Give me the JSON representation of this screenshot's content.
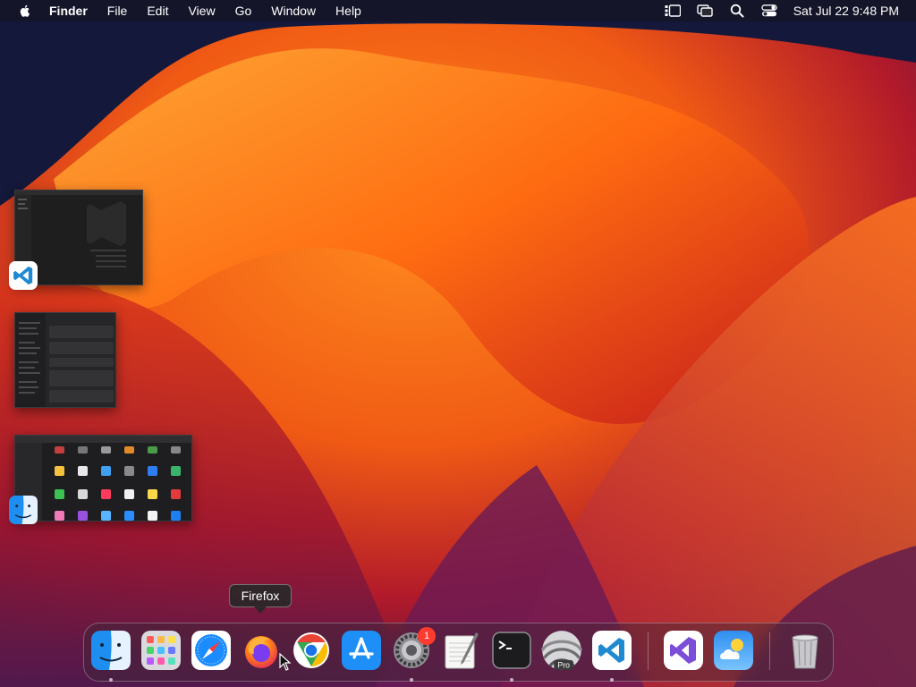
{
  "menubar": {
    "app_name": "Finder",
    "items": [
      "File",
      "Edit",
      "View",
      "Go",
      "Window",
      "Help"
    ],
    "status_icons": [
      "stage-manager-icon",
      "screen-mirroring-icon",
      "spotlight-search-icon",
      "control-center-icon"
    ],
    "clock": "Sat Jul 22  9:48 PM"
  },
  "stage_manager": [
    {
      "app": "Visual Studio Code",
      "icon": "vscode-icon"
    },
    {
      "app": "System Settings",
      "icon": "settings-window-thumbnail"
    },
    {
      "app": "Finder",
      "icon": "finder-icon"
    }
  ],
  "tooltip": {
    "label": "Firefox"
  },
  "dock": {
    "items": [
      {
        "name": "Finder",
        "icon": "finder-icon",
        "running": true
      },
      {
        "name": "Launchpad",
        "icon": "launchpad-icon",
        "running": false
      },
      {
        "name": "Safari",
        "icon": "safari-icon",
        "running": false
      },
      {
        "name": "Firefox",
        "icon": "firefox-icon",
        "running": false
      },
      {
        "name": "Google Chrome",
        "icon": "chrome-icon",
        "running": false
      },
      {
        "name": "App Store",
        "icon": "app-store-icon",
        "running": false
      },
      {
        "name": "System Settings",
        "icon": "settings-gear-icon",
        "running": true,
        "badge": "1"
      },
      {
        "name": "TextEdit",
        "icon": "textedit-icon",
        "running": false
      },
      {
        "name": "Terminal",
        "icon": "terminal-icon",
        "running": true
      },
      {
        "name": "Pro",
        "icon": "pro-app-icon",
        "running": false,
        "label": "Pro"
      },
      {
        "name": "Visual Studio Code",
        "icon": "vscode-icon",
        "running": true
      },
      {
        "name": "Visual Studio",
        "icon": "visual-studio-icon",
        "running": false
      },
      {
        "name": "Weather",
        "icon": "weather-icon",
        "running": false
      },
      {
        "name": "Trash",
        "icon": "trash-icon",
        "running": false
      }
    ]
  },
  "colors": {
    "wallpaper_orange": "#ff7a1a",
    "wallpaper_red": "#c8102e",
    "wallpaper_purple": "#5a1b57",
    "badge_red": "#ff3b30"
  }
}
